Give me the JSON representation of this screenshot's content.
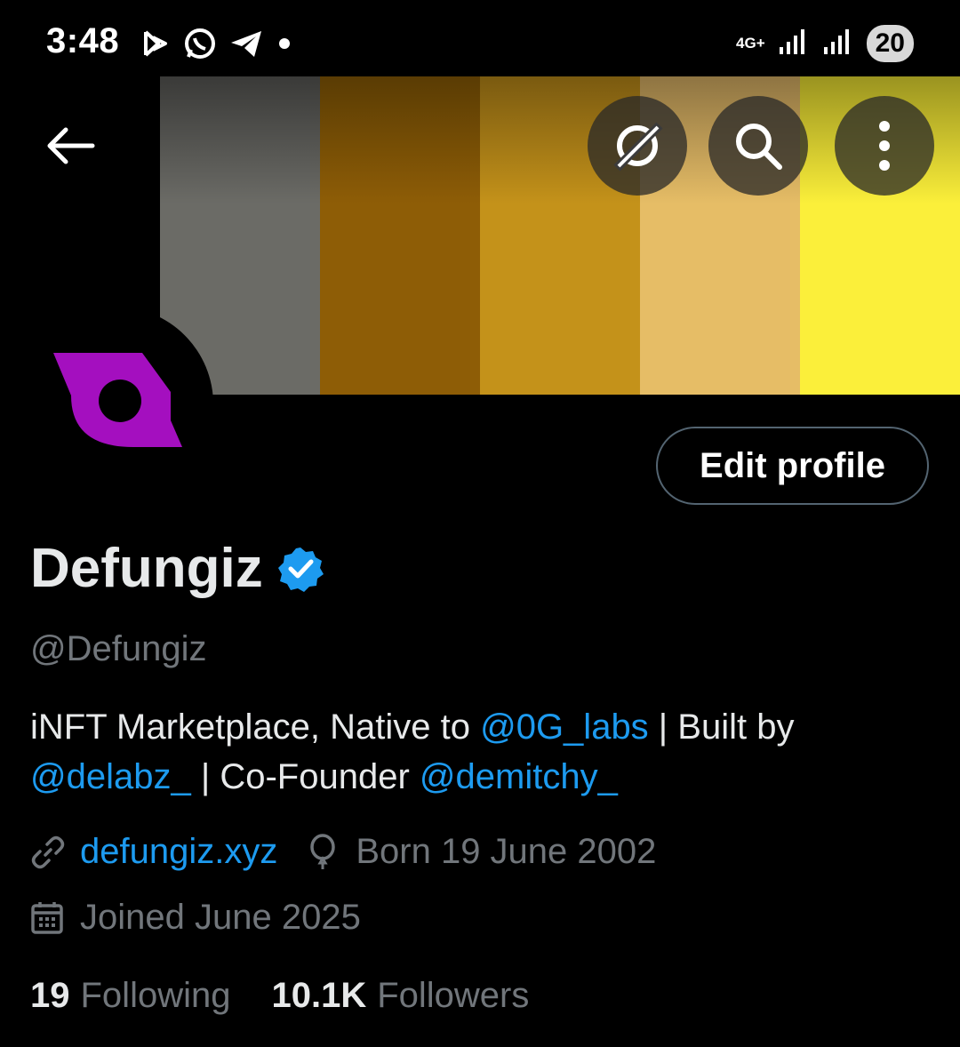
{
  "status_bar": {
    "time": "3:48",
    "network": "4G+",
    "battery": "20"
  },
  "banner": {
    "stripes": [
      "#6b6b66",
      "#8e5d06",
      "#c4921a",
      "#e6bd66",
      "#fbef3a"
    ]
  },
  "actions": {
    "edit_profile": "Edit profile"
  },
  "profile": {
    "display_name": "Defungiz",
    "handle": "@Defungiz",
    "bio": {
      "part1": "iNFT Marketplace, Native to ",
      "mention1": "@0G_labs",
      "part2": " | Built by",
      "mention2": "@delabz_",
      "part3": " | Co-Founder ",
      "mention3": "@demitchy_"
    },
    "website": "defungiz.xyz",
    "birthday": "Born 19 June 2002",
    "joined": "Joined June 2025",
    "following_count": "19",
    "following_label": "Following",
    "followers_count": "10.1K",
    "followers_label": "Followers"
  },
  "colors": {
    "accent": "#1d9bf0",
    "avatar_logo": "#a40fbf"
  }
}
